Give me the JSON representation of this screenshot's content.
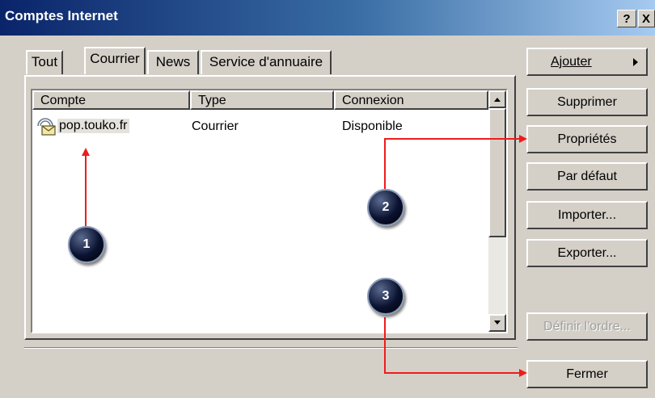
{
  "window": {
    "title": "Comptes Internet",
    "help_label": "?",
    "close_label": "X"
  },
  "tabs": [
    {
      "label": "Tout"
    },
    {
      "label": "Courrier"
    },
    {
      "label": "News"
    },
    {
      "label": "Service d'annuaire"
    }
  ],
  "list": {
    "columns": [
      "Compte",
      "Type",
      "Connexion"
    ],
    "rows": [
      {
        "compte": "pop.touko.fr",
        "type": "Courrier",
        "connexion": "Disponible"
      }
    ]
  },
  "buttons": {
    "ajouter": "Ajouter",
    "supprimer": "Supprimer",
    "proprietes": "Propriétés",
    "par_defaut": "Par défaut",
    "importer": "Importer...",
    "exporter": "Exporter...",
    "definir_ordre": "Définir l'ordre...",
    "fermer": "Fermer"
  },
  "annotations": [
    "1",
    "2",
    "3"
  ],
  "colors": {
    "arrow": "#ee1c1c",
    "dialog": "#d4d0c8",
    "title_start": "#0a246a",
    "title_end": "#a6caf0"
  }
}
